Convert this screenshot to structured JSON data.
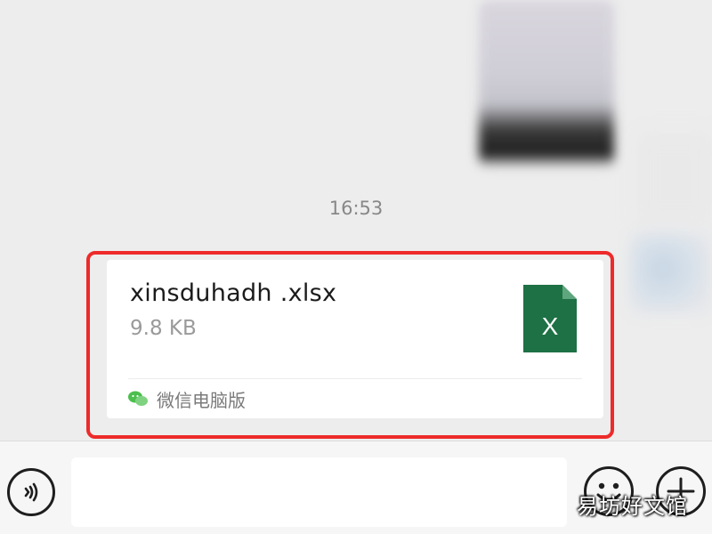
{
  "chat": {
    "timestamp": "16:53",
    "message": {
      "file_name": "xinsduhadh .xlsx",
      "file_size": "9.8 KB",
      "file_icon": "excel-file-icon",
      "file_icon_letter": "X",
      "source_icon": "wechat-icon",
      "source_label": "微信电脑版"
    }
  },
  "input_bar": {
    "message_value": "",
    "voice_icon": "voice-icon",
    "emoji_icon": "emoji-icon",
    "plus_icon": "plus-icon"
  },
  "watermark": "易坊好文馆",
  "colors": {
    "background": "#ededed",
    "card": "#ffffff",
    "excel_green": "#1e7145",
    "highlight_red": "#ee2a2a",
    "wechat_green": "#4cbf4e"
  }
}
